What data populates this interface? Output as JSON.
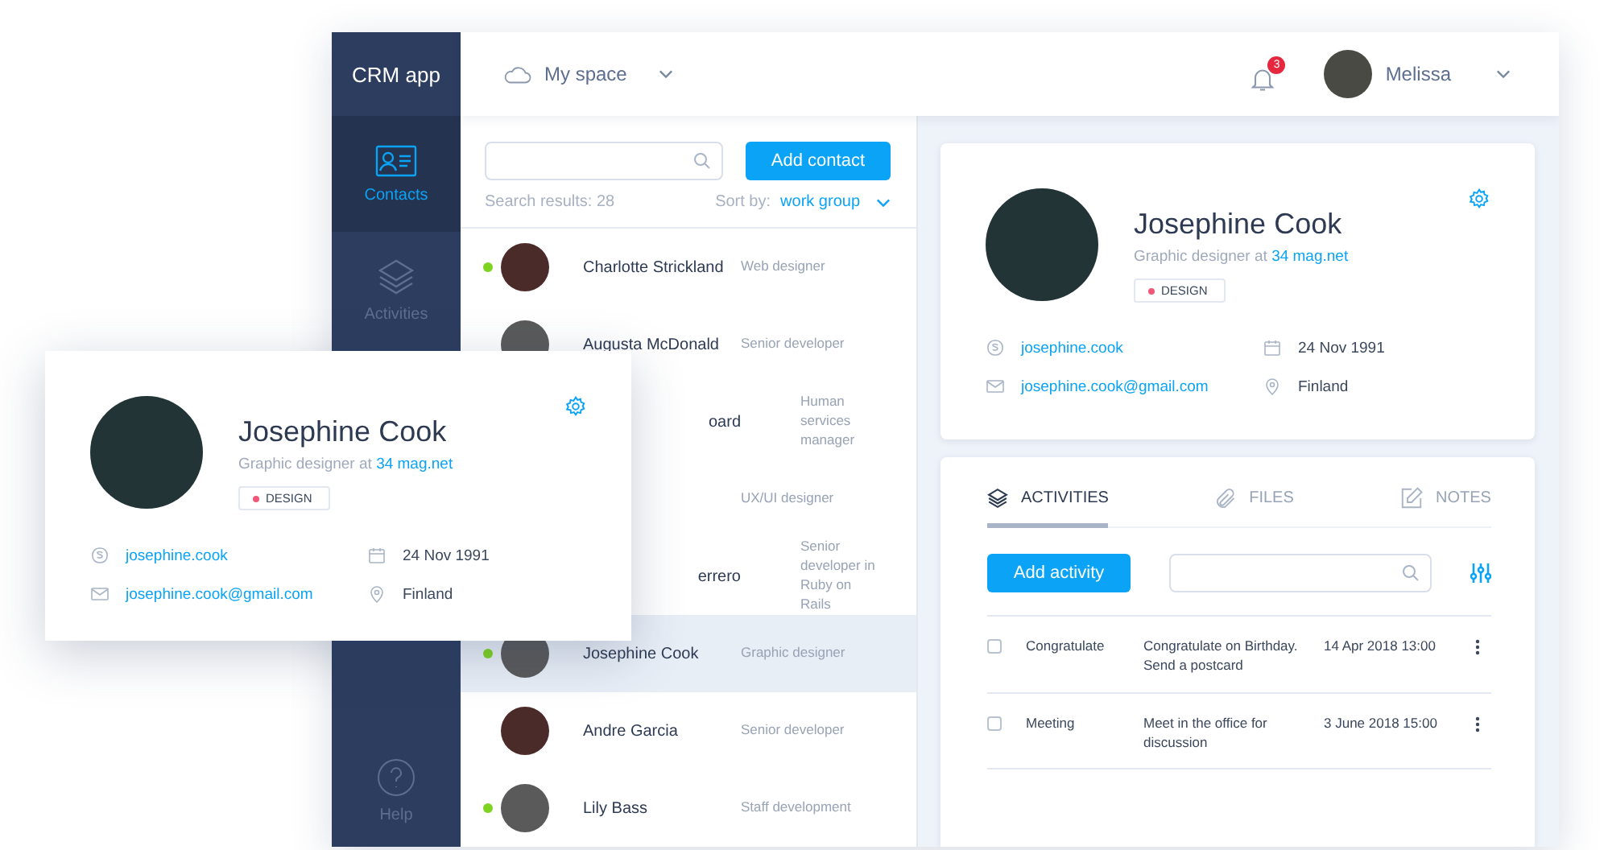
{
  "sidebar": {
    "logo": "CRM app",
    "items": [
      {
        "label": "Contacts",
        "selected": true
      },
      {
        "label": "Activities",
        "selected": false
      }
    ],
    "help": "Help"
  },
  "header": {
    "space": "My space",
    "notifications": "3",
    "user": "Melissa"
  },
  "contacts": {
    "add_button": "Add contact",
    "results": "Search results: 28",
    "sort_label": "Sort by:",
    "sort_value": "work group",
    "rows": [
      {
        "kind": "full",
        "name": "Charlotte Strickland",
        "role": "Web designer",
        "online": true,
        "selected": false
      },
      {
        "kind": "full",
        "name": "Augusta McDonald",
        "role": "Senior developer",
        "online": false,
        "selected": false
      },
      {
        "kind": "partial",
        "name": "oard",
        "role": "Human services manager",
        "selected": false
      },
      {
        "kind": "hidden",
        "role": "UX/UI designer",
        "selected": false
      },
      {
        "kind": "partial",
        "name": "errero",
        "role": "Senior developer in Ruby on Rails",
        "selected": false
      },
      {
        "kind": "full",
        "name": "Josephine Cook",
        "role": "Graphic designer",
        "online": true,
        "selected": true
      },
      {
        "kind": "full",
        "name": "Andre Garcia",
        "role": "Senior developer",
        "online": false,
        "selected": false
      },
      {
        "kind": "full",
        "name": "Lily Bass",
        "role": "Staff development",
        "online": true,
        "selected": false
      }
    ]
  },
  "profile_card": {
    "name": "Josephine Cook",
    "job": "Graphic designer at",
    "company": "34 mag.net",
    "tag": "DESIGN",
    "details": [
      {
        "kind": "skype",
        "value": "josephine.cook"
      },
      {
        "kind": "birthday",
        "value": "24 Nov 1991"
      },
      {
        "kind": "email",
        "value": "josephine.cook@gmail.com"
      },
      {
        "kind": "location",
        "value": "Finland"
      }
    ]
  },
  "activities_card": {
    "tabs": [
      {
        "label": "ACTIVITIES",
        "selected": true
      },
      {
        "label": "FILES",
        "selected": false
      },
      {
        "label": "NOTES",
        "selected": false
      }
    ],
    "add_button": "Add activity",
    "rows": [
      {
        "checked": false,
        "type": "Congratulate",
        "description": "Congratulate on Birthday. Send a postcard",
        "date": "14 Apr 2018 13:00"
      },
      {
        "checked": false,
        "type": "Meeting",
        "description": "Meet in the office for discussion",
        "date": "3 June 2018 15:00"
      }
    ]
  },
  "floating_card": {
    "name": "Josephine Cook",
    "job": "Graphic designer at",
    "company": "34 mag.net",
    "tag": "DESIGN",
    "details": [
      {
        "kind": "skype",
        "value": "josephine.cook"
      },
      {
        "kind": "birthday",
        "value": "24 Nov 1991"
      },
      {
        "kind": "email",
        "value": "josephine.cook@gmail.com"
      },
      {
        "kind": "location",
        "value": "Finland"
      }
    ]
  }
}
